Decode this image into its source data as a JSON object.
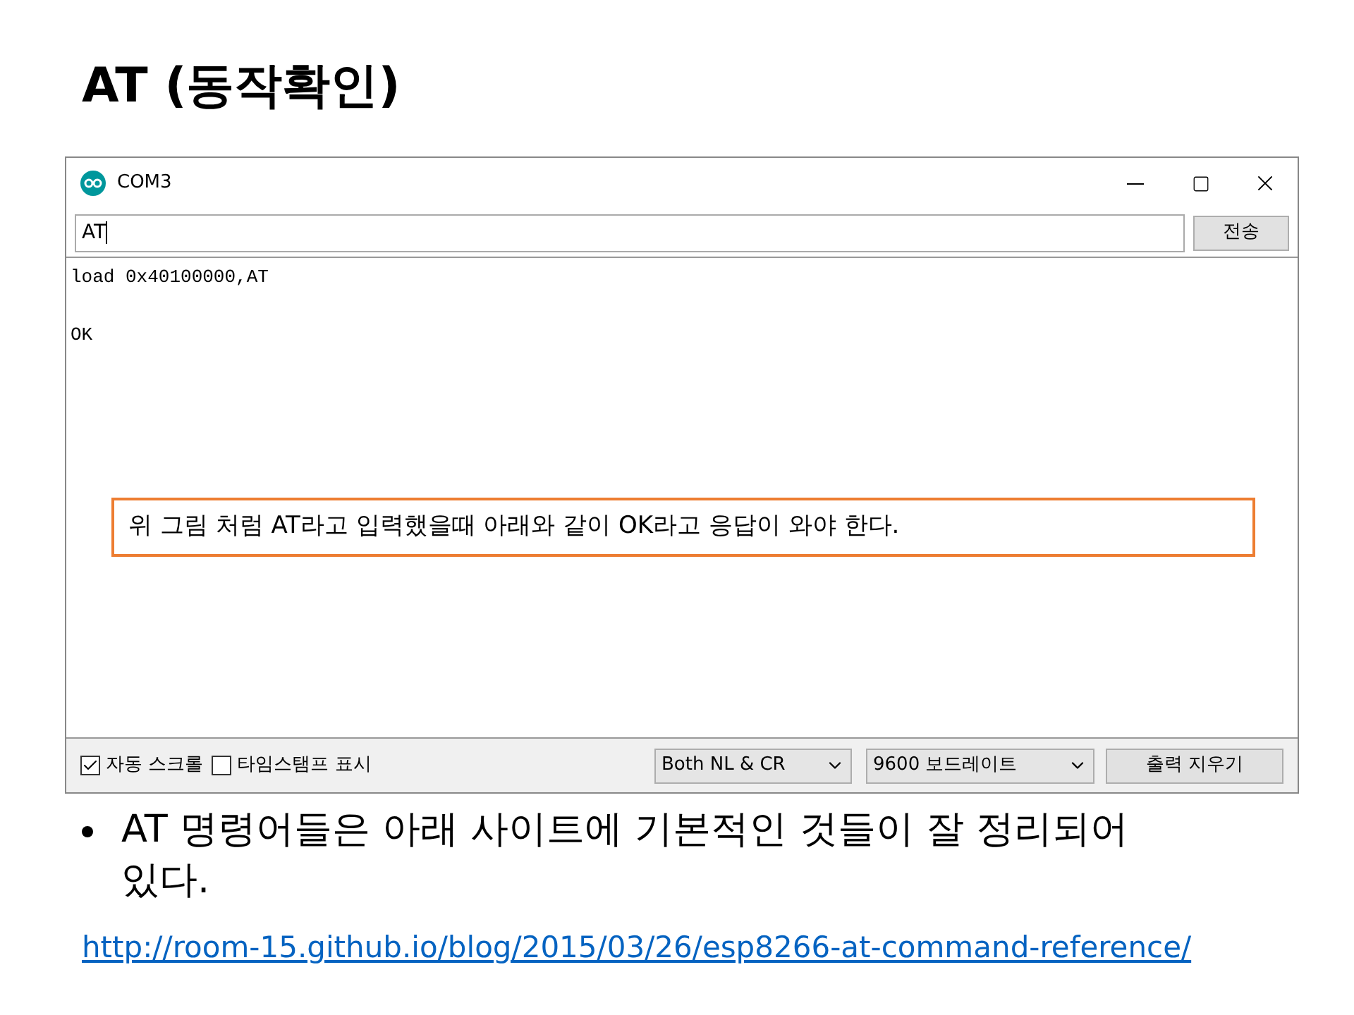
{
  "slide_title": "AT (동작확인)",
  "window": {
    "title": "COM3",
    "input_value": "AT",
    "send_button": "전송",
    "output_lines": [
      "load 0x40100000,AT",
      "OK"
    ],
    "callout": "위 그림 처럼 AT라고 입력했을때 아래와 같이 OK라고 응답이 와야 한다.",
    "options": [
      {
        "label": "자동 스크롤",
        "checked": true
      },
      {
        "label": "타임스탬프 표시",
        "checked": false
      }
    ],
    "line_ending": "Both NL & CR",
    "baud_rate": "9600 보드레이트",
    "clear_button": "출력 지우기"
  },
  "bullets": [
    "AT 명령어들은 아래 사이트에 기본적인 것들이 잘 정리되어있다."
  ],
  "link": "http://room-15.github.io/blog/2015/03/26/esp8266-at-command-reference/"
}
